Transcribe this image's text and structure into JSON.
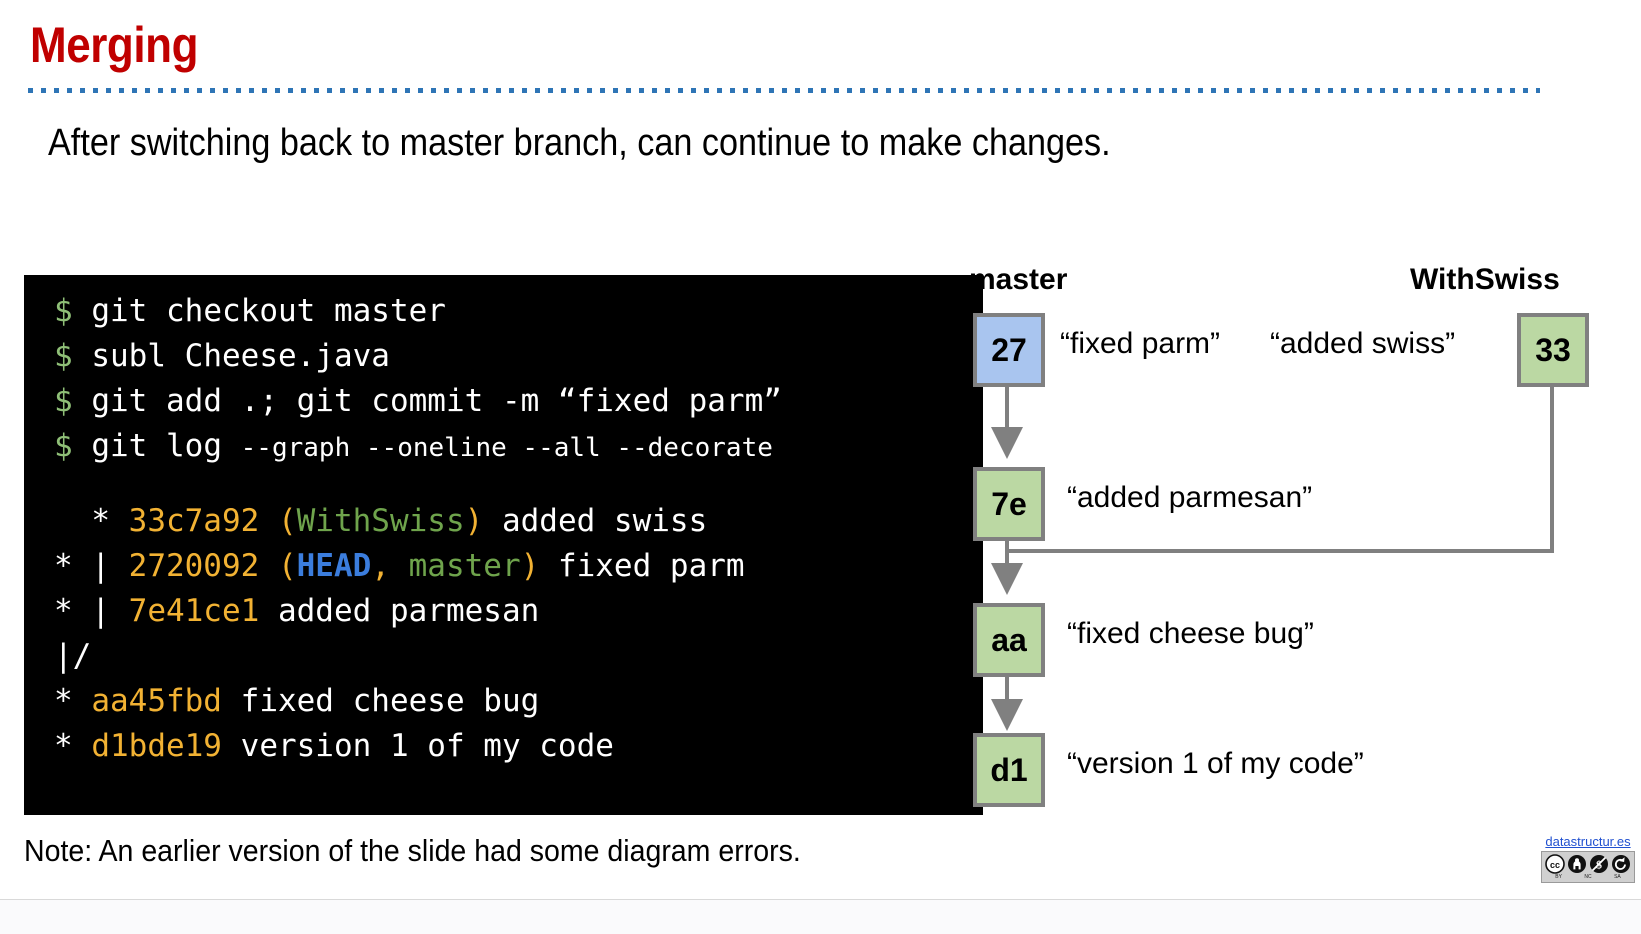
{
  "slide": {
    "title": "Merging",
    "subtitle": "After switching back to master branch, can continue to make changes.",
    "footer_note": "Note: An earlier version of the slide had some diagram errors.",
    "accent_color": "#C00000",
    "rule_color": "#2E75B6"
  },
  "terminal": {
    "background": "#000000",
    "prompt_color": "#8FBF77",
    "hash_color": "#F2B233",
    "branch_color": "#6FA44C",
    "head_color": "#3B7DDD",
    "lines": [
      {
        "prompt": "$",
        "command": "git checkout master"
      },
      {
        "prompt": "$",
        "command": "subl Cheese.java"
      },
      {
        "prompt": "$",
        "command": "git add .; git commit -m “fixed parm”"
      },
      {
        "prompt": "$",
        "command": "git log ",
        "flags": "--graph --oneline --all --decorate"
      }
    ],
    "log": [
      {
        "graph": "  * ",
        "hash": "33c7a92",
        "open": " (",
        "refs": [
          {
            "text": "WithSwiss",
            "kind": "branch"
          }
        ],
        "close": ") ",
        "message": "added swiss"
      },
      {
        "graph": "* | ",
        "hash": "2720092",
        "open": " (",
        "refs": [
          {
            "text": "HEAD",
            "kind": "head"
          },
          {
            "text": ", ",
            "kind": "plain"
          },
          {
            "text": "master",
            "kind": "branch"
          }
        ],
        "close": ") ",
        "message": "fixed parm"
      },
      {
        "graph": "* | ",
        "hash": "7e41ce1",
        "open": " ",
        "refs": [],
        "close": "",
        "message": "added parmesan"
      },
      {
        "graph": "|/",
        "hash": "",
        "open": "",
        "refs": [],
        "close": "",
        "message": ""
      },
      {
        "graph": "* ",
        "hash": "aa45fbd",
        "open": " ",
        "refs": [],
        "close": "",
        "message": "fixed cheese bug"
      },
      {
        "graph": "* ",
        "hash": "d1bde19",
        "open": " ",
        "refs": [],
        "close": "",
        "message": "version 1 of my code"
      }
    ]
  },
  "diagram": {
    "branch_labels": {
      "master": "master",
      "with_swiss": "WithSwiss"
    },
    "node_colors": {
      "head": "#A9C5EF",
      "normal": "#BBD8A3",
      "border": "#808080",
      "connector": "#808080"
    },
    "nodes": [
      {
        "id": "27",
        "label": "27",
        "message": "“fixed parm”",
        "color": "head"
      },
      {
        "id": "33",
        "label": "33",
        "message": "“added swiss”",
        "color": "normal"
      },
      {
        "id": "7e",
        "label": "7e",
        "message": "“added parmesan”",
        "color": "normal"
      },
      {
        "id": "aa",
        "label": "aa",
        "message": "“fixed cheese bug”",
        "color": "normal"
      },
      {
        "id": "d1",
        "label": "d1",
        "message": "“version 1 of my code”",
        "color": "normal"
      }
    ]
  },
  "attribution": {
    "link_text": "datastructur.es",
    "license": "CC BY-NC-SA",
    "badge_letters": {
      "cc": "cc",
      "by": "BY",
      "nc": "NC",
      "sa": "SA"
    }
  }
}
